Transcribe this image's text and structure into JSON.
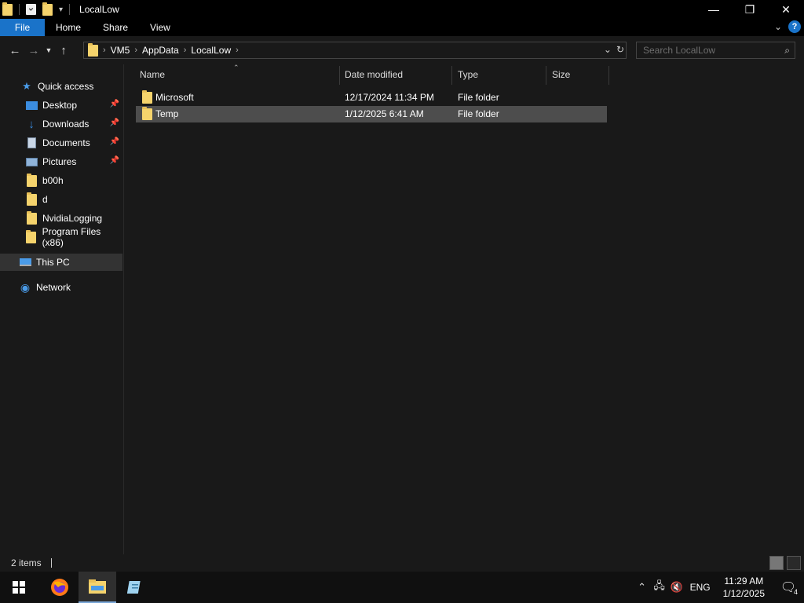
{
  "window": {
    "title": "LocalLow"
  },
  "ribbon": {
    "tabs": [
      "File",
      "Home",
      "Share",
      "View"
    ],
    "help": "?"
  },
  "address": {
    "crumbs": [
      "VM5",
      "AppData",
      "LocalLow"
    ]
  },
  "search": {
    "placeholder": "Search LocalLow"
  },
  "sidebar": {
    "items": [
      {
        "label": "Quick access",
        "icon": "star-icon"
      },
      {
        "label": "Desktop",
        "icon": "desktop-icon",
        "pinned": true
      },
      {
        "label": "Downloads",
        "icon": "download-icon",
        "pinned": true
      },
      {
        "label": "Documents",
        "icon": "documents-icon",
        "pinned": true
      },
      {
        "label": "Pictures",
        "icon": "pictures-icon",
        "pinned": true
      },
      {
        "label": "b00h",
        "icon": "folder-icon"
      },
      {
        "label": "d",
        "icon": "folder-icon"
      },
      {
        "label": "NvidiaLogging",
        "icon": "folder-icon"
      },
      {
        "label": "Program Files (x86)",
        "icon": "folder-icon"
      },
      {
        "label": "This PC",
        "icon": "computer-icon",
        "selected": true
      },
      {
        "label": "Network",
        "icon": "network-icon"
      }
    ]
  },
  "columns": [
    "Name",
    "Date modified",
    "Type",
    "Size"
  ],
  "files": [
    {
      "name": "Microsoft",
      "date": "12/17/2024 11:34 PM",
      "type": "File folder",
      "size": ""
    },
    {
      "name": "Temp",
      "date": "1/12/2025 6:41 AM",
      "type": "File folder",
      "size": "",
      "selected": true
    }
  ],
  "status": {
    "count": "2 items"
  },
  "taskbar": {
    "apps": [
      "windows-start-icon",
      "firefox-icon",
      "file-explorer-icon",
      "notepad-icon"
    ],
    "tray": {
      "language": "ENG",
      "time": "11:29 AM",
      "date": "1/12/2025",
      "notifications": "4"
    }
  },
  "colors": {
    "accent": "#1a73c9",
    "folder": "#f5d36c",
    "selection": "#4d4d4d"
  }
}
